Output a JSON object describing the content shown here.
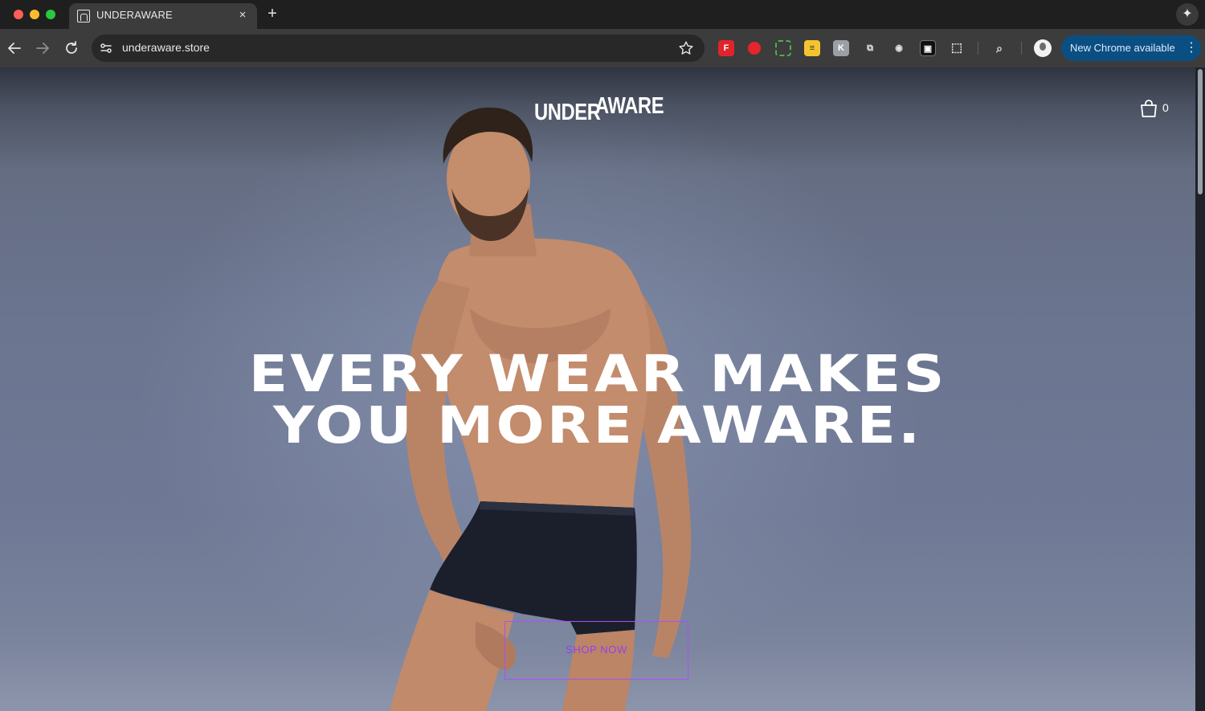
{
  "browser": {
    "tab_title": "UNDERAWARE",
    "tab_close_glyph": "×",
    "new_tab_glyph": "+",
    "gemini_glyph": "✦",
    "url": "underaware.store",
    "update_label": "New Chrome available",
    "icons": [
      "back-icon",
      "forward-icon",
      "reload-icon",
      "site-info-icon",
      "star-icon",
      "extensions-icon",
      "tab-search-icon",
      "profile-avatar",
      "more-icon"
    ]
  },
  "site": {
    "logo_under": "UNDER",
    "logo_aware": "AWARE",
    "cart_count": "0",
    "headline_line1": "EVERY WEAR MAKES",
    "headline_line2": "YOU MORE AWARE.",
    "cta_label": "SHOP NOW"
  },
  "colors": {
    "accent_purple": "#b14cff",
    "chrome_update_blue": "#0b4f82"
  }
}
